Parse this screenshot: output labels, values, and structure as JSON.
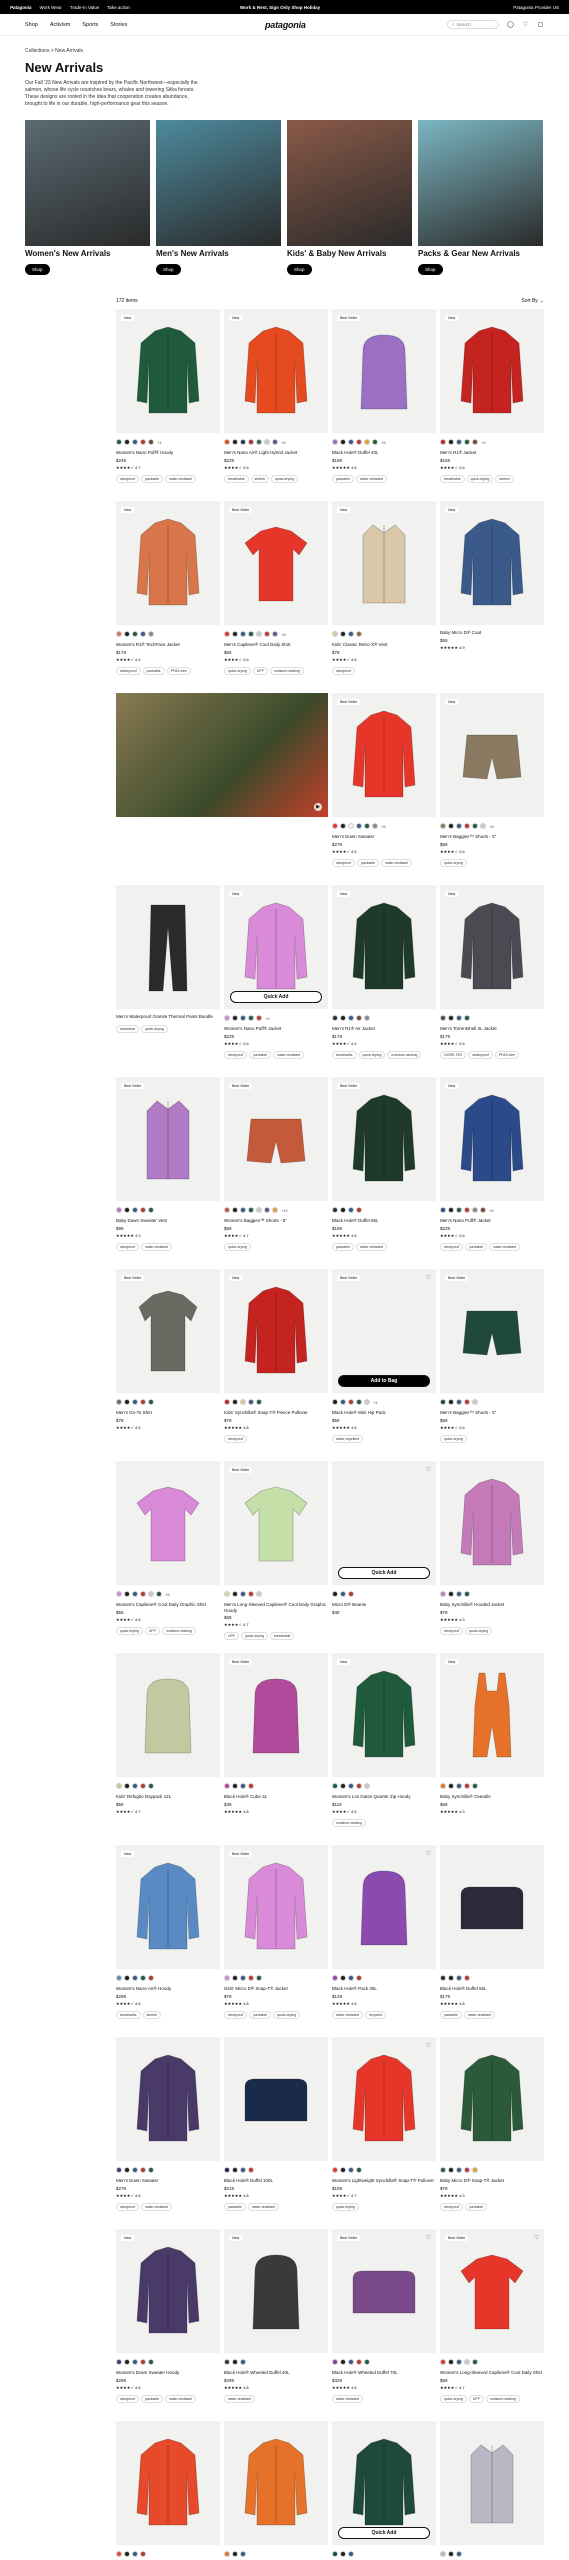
{
  "topbar": {
    "brand": "Patagonia",
    "links": [
      "Work Wear",
      "Trade-In Value",
      "Take action"
    ],
    "promo": "Work & Rest, Sign Only Shop Holiday",
    "locale": "Patagonia Provider US"
  },
  "nav": {
    "brand": "patagonia",
    "links": [
      "Shop",
      "Activism",
      "Sports",
      "Stories"
    ],
    "search": "Search"
  },
  "breadcrumb": {
    "parent": "Collections",
    "sep": ">",
    "current": "New Arrivals"
  },
  "page": {
    "title": "New Arrivals",
    "intro": "Our Fall '23 New Arrivals are inspired by the Pacific Northwest—especially the salmon, whose life cycle nourishes bears, whales and towering Sitka forests. These designs are rooted in the idea that cooperation creates abundance, brought to life in our durable, high-performance gear this season."
  },
  "categories": [
    {
      "label": "Women's New Arrivals",
      "cta": "Shop",
      "color": "#5a6b73"
    },
    {
      "label": "Men's New Arrivals",
      "cta": "Shop",
      "color": "#4d8a9e"
    },
    {
      "label": "Kids' & Baby New Arrivals",
      "cta": "Shop",
      "color": "#8a5a48"
    },
    {
      "label": "Packs & Gear New Arrivals",
      "cta": "Shop",
      "color": "#7bb6c2"
    }
  ],
  "listing": {
    "count": "172 items",
    "sort": "Sort By"
  },
  "colors": {
    "accent": "#000000"
  },
  "products": [
    {
      "badge": "New",
      "color": "#1f5a3d",
      "shape": "jacket",
      "swatches": [
        "#1f5a3d",
        "#222",
        "#3b5a8a",
        "#b33",
        "#6b4a3a"
      ],
      "more": "+4",
      "name": "Women's Nano Puff® Hoody",
      "price": "$249",
      "rating": "★★★★☆ 4.7",
      "tags": [
        "windproof",
        "packable",
        "water-resistant"
      ]
    },
    {
      "badge": "New",
      "color": "#e64a1f",
      "shape": "jacket",
      "swatches": [
        "#e64a1f",
        "#222",
        "#1f3a5a",
        "#a33",
        "#3b6b4a",
        "#ccc",
        "#6b4a8a"
      ],
      "more": "+6",
      "name": "Men's Nano Air® Light Hybrid Jacket",
      "price": "$229",
      "rating": "★★★★☆ 4.5",
      "tags": [
        "breathable",
        "stretch",
        "quick-drying"
      ]
    },
    {
      "badge": "Best Seller",
      "color": "#9b6fc4",
      "shape": "bag",
      "swatches": [
        "#9b6fc4",
        "#222",
        "#3b5a8a",
        "#b33",
        "#e6a23a",
        "#1f5a3d"
      ],
      "more": "+8",
      "name": "Black Hole® Duffel 40L",
      "price": "$169",
      "rating": "★★★★★ 4.8",
      "tags": [
        "packable",
        "water-resistant"
      ]
    },
    {
      "badge": "New",
      "color": "#c4231f",
      "shape": "jacket",
      "swatches": [
        "#c4231f",
        "#222",
        "#3b5a8a",
        "#1f5a3d",
        "#6b4a3a"
      ],
      "more": "+4",
      "name": "Men's R1® Jacket",
      "price": "$159",
      "rating": "★★★★☆ 4.6",
      "tags": [
        "breathable",
        "quick-drying",
        "stretch"
      ]
    },
    {
      "badge": "New",
      "color": "#d9754a",
      "shape": "jacket",
      "swatches": [
        "#d9754a",
        "#222",
        "#1f5a3d",
        "#3b5a8a",
        "#8a8a8a"
      ],
      "more": "",
      "name": "Women's R1® TechFace Jacket",
      "price": "$179",
      "rating": "★★★★☆ 4.4",
      "tags": [
        "waterproof",
        "packable",
        "PFAS-free"
      ]
    },
    {
      "badge": "Best Seller",
      "color": "#e6362a",
      "shape": "tee",
      "swatches": [
        "#e6362a",
        "#222",
        "#3b5a8a",
        "#1f5a3d",
        "#ccc",
        "#b33",
        "#6b4a8a"
      ],
      "more": "+8",
      "name": "Men's Capilene® Cool Daily Shirt",
      "price": "$55",
      "rating": "★★★★☆ 4.6",
      "tags": [
        "quick-drying",
        "UPF",
        "moisture-wicking"
      ]
    },
    {
      "badge": "New",
      "color": "#d9c8a8",
      "shape": "vest",
      "swatches": [
        "#d9c8a8",
        "#222",
        "#3b5a8a",
        "#8a6b4a"
      ],
      "more": "",
      "name": "Kids' Classic Retro-X® Vest",
      "price": "$79",
      "rating": "★★★★☆ 4.8",
      "tags": [
        "windproof"
      ]
    },
    {
      "badge": "New",
      "color": "#3a5a8a",
      "shape": "jacket",
      "swatches": [],
      "more": "",
      "name": "Baby Micro D® Coat",
      "price": "$59",
      "rating": "★★★★★ 4.9",
      "tags": []
    },
    {
      "feature": true,
      "color": "#6a6a52"
    },
    {
      "badge": "Best Seller",
      "color": "#e6362a",
      "shape": "jacket",
      "swatches": [
        "#e6362a",
        "#222",
        "#f1f1ef",
        "#3b5a8a",
        "#1f5a3d",
        "#8a8a8a"
      ],
      "more": "+8",
      "name": "Men's Down Sweater",
      "price": "$279",
      "rating": "★★★★☆ 4.5",
      "tags": [
        "windproof",
        "packable",
        "water-resistant"
      ]
    },
    {
      "badge": "New",
      "color": "#8a7a62",
      "shape": "shorts",
      "swatches": [
        "#8a7a62",
        "#222",
        "#3b5a8a",
        "#b33",
        "#1f5a3d",
        "#ccc"
      ],
      "more": "+8",
      "name": "Men's Baggies™ Shorts - 5\"",
      "price": "$59",
      "rating": "★★★★☆ 4.6",
      "tags": [
        "quick-drying"
      ]
    },
    {
      "badge": "",
      "color": "#2a2a2a",
      "shape": "pants",
      "swatches": [],
      "more": "",
      "name": "Men's Waterproof Granite Thermal Pants Bundle",
      "price": "",
      "rating": "",
      "tags": [
        "workwear",
        "quick-drying"
      ]
    },
    {
      "badge": "New",
      "color": "#d98ad9",
      "shape": "jacket",
      "qa": "Quick Add",
      "qaDark": false,
      "swatches": [
        "#d98ad9",
        "#222",
        "#3b5a8a",
        "#1f5a3d",
        "#b33"
      ],
      "more": "+4",
      "name": "Women's Nano Puff® Jacket",
      "price": "$229",
      "rating": "★★★★☆ 4.6",
      "tags": [
        "windproof",
        "packable",
        "water-resistant"
      ]
    },
    {
      "badge": "New",
      "color": "#1f3a2a",
      "shape": "jacket",
      "swatches": [
        "#1f3a2a",
        "#222",
        "#3b5a8a",
        "#6b4a3a",
        "#8a8a8a"
      ],
      "more": "",
      "name": "Men's R1® Air Jacket",
      "price": "$179",
      "rating": "★★★★☆ 4.4",
      "tags": [
        "breathable",
        "quick-drying",
        "moisture-wicking"
      ]
    },
    {
      "badge": "New",
      "color": "#4a4a52",
      "shape": "jacket",
      "swatches": [
        "#4a4a52",
        "#222",
        "#3b5a8a",
        "#1f5a3d"
      ],
      "more": "",
      "name": "Men's Torrentshell 3L Jacket",
      "price": "$179",
      "rating": "★★★★☆ 4.5",
      "tags": [
        "GORE-TEX",
        "waterproof",
        "PFAS-free"
      ]
    },
    {
      "badge": "Best Seller",
      "color": "#b07ac4",
      "shape": "vest",
      "swatches": [
        "#b07ac4",
        "#222",
        "#3b5a8a",
        "#b33",
        "#1f5a3d"
      ],
      "more": "",
      "name": "Baby Down Sweater Vest",
      "price": "$99",
      "rating": "★★★★★ 4.9",
      "tags": [
        "windproof",
        "water-resistant"
      ]
    },
    {
      "badge": "Best Seller",
      "color": "#c45a3a",
      "shape": "shorts",
      "swatches": [
        "#c45a3a",
        "#222",
        "#3b5a8a",
        "#1f5a3d",
        "#ccc",
        "#6b4a8a",
        "#e6a23a"
      ],
      "more": "+12",
      "name": "Women's Baggies™ Shorts - 5\"",
      "price": "$59",
      "rating": "★★★★☆ 4.7",
      "tags": [
        "quick-drying"
      ]
    },
    {
      "badge": "Best Seller",
      "color": "#1f3a2a",
      "shape": "jacket",
      "swatches": [
        "#1f3a2a",
        "#222",
        "#3b5a8a",
        "#b33"
      ],
      "more": "",
      "name": "Black Hole® Duffel 55L",
      "price": "$189",
      "rating": "★★★★★ 4.8",
      "tags": [
        "packable",
        "water-resistant"
      ]
    },
    {
      "badge": "New",
      "color": "#2a4a8a",
      "shape": "jacket",
      "swatches": [
        "#2a4a8a",
        "#222",
        "#1f5a3d",
        "#b33",
        "#8a8a8a",
        "#6b4a3a"
      ],
      "more": "+6",
      "name": "Men's Nano Puff® Jacket",
      "price": "$229",
      "rating": "★★★★☆ 4.6",
      "tags": [
        "windproof",
        "packable",
        "water-resistant"
      ]
    },
    {
      "badge": "Best Seller",
      "color": "#6a6a62",
      "shape": "shirt",
      "swatches": [
        "#6a6a62",
        "#222",
        "#3b5a8a",
        "#b33",
        "#1f5a3d"
      ],
      "more": "",
      "name": "Men's Go-To Shirt",
      "price": "$79",
      "rating": "★★★★☆ 4.5",
      "tags": []
    },
    {
      "badge": "New",
      "color": "#c4231f",
      "shape": "jacket",
      "swatches": [
        "#c4231f",
        "#222",
        "#d9c8a8",
        "#3b5a8a",
        "#1f5a3d"
      ],
      "more": "",
      "name": "Kids' Synchilla® Snap-T® Fleece Pullover",
      "price": "$79",
      "rating": "★★★★★ 4.8",
      "tags": [
        "windproof"
      ]
    },
    {
      "badge": "Best Seller",
      "color": "#f1f1ef",
      "shape": "none",
      "qa": "Add to Bag",
      "qaDark": true,
      "heart": true,
      "swatches": [
        "#222",
        "#3b5a8a",
        "#b33",
        "#1f5a3d",
        "#ccc"
      ],
      "more": "+4",
      "name": "Black Hole® Mini Hip Pack",
      "price": "$59",
      "rating": "★★★★★ 4.8",
      "tags": [
        "water-repellent"
      ]
    },
    {
      "badge": "Best Seller",
      "color": "#1f4a3a",
      "shape": "shorts",
      "swatches": [
        "#1f4a3a",
        "#222",
        "#3b5a8a",
        "#b33",
        "#ccc"
      ],
      "more": "",
      "name": "Men's Baggies™ Shorts - 5\"",
      "price": "$59",
      "rating": "★★★★☆ 4.6",
      "tags": [
        "quick-drying"
      ]
    },
    {
      "badge": "",
      "color": "#d98ad9",
      "shape": "tee",
      "swatches": [
        "#d98ad9",
        "#222",
        "#3b5a8a",
        "#b33",
        "#ccc",
        "#1f5a3d"
      ],
      "more": "+8",
      "name": "Women's Capilene® Cool Daily Graphic Shirt",
      "price": "$55",
      "rating": "★★★★☆ 4.6",
      "tags": [
        "quick-drying",
        "UPF",
        "moisture-wicking"
      ]
    },
    {
      "badge": "Best Seller",
      "color": "#c4e0a8",
      "shape": "tee",
      "swatches": [
        "#c4e0a8",
        "#222",
        "#3b5a8a",
        "#b33",
        "#ccc"
      ],
      "more": "",
      "name": "Men's Long-Sleeved Capilene® Cool Daily Graphic Hoody",
      "price": "$69",
      "rating": "★★★★☆ 4.7",
      "tags": [
        "UPF",
        "quick-drying",
        "breathable"
      ]
    },
    {
      "badge": "",
      "color": "#f1f1ef",
      "shape": "none",
      "qa": "Quick Add",
      "qaDark": false,
      "heart": true,
      "swatches": [
        "#222",
        "#3b5a8a",
        "#b33"
      ],
      "more": "",
      "name": "Micro D® Beanie",
      "price": "$49",
      "rating": "",
      "tags": []
    },
    {
      "badge": "",
      "color": "#c47ab8",
      "shape": "jacket",
      "swatches": [
        "#c47ab8",
        "#222",
        "#3b5a8a",
        "#1f5a3d"
      ],
      "more": "",
      "name": "Baby Synchilla® Hooded Jacket",
      "price": "$79",
      "rating": "★★★★★ 4.9",
      "tags": [
        "windproof",
        "quick-drying"
      ]
    },
    {
      "badge": "",
      "color": "#c4c8a0",
      "shape": "bag",
      "swatches": [
        "#c4c8a0",
        "#222",
        "#3b5a8a",
        "#b33",
        "#1f5a3d"
      ],
      "more": "",
      "name": "Kids' Refugito Daypack 12L",
      "price": "$59",
      "rating": "★★★★☆ 4.7",
      "tags": []
    },
    {
      "badge": "Best Seller",
      "color": "#b04a9a",
      "shape": "bag",
      "swatches": [
        "#b04a9a",
        "#222",
        "#3b5a8a",
        "#b33"
      ],
      "more": "",
      "name": "Black Hole® Cube 3L",
      "price": "$39",
      "rating": "★★★★★ 4.8",
      "tags": []
    },
    {
      "badge": "New",
      "color": "#1f5a3d",
      "shape": "jacket",
      "swatches": [
        "#1f5a3d",
        "#222",
        "#3b5a8a",
        "#b33",
        "#ccc"
      ],
      "more": "",
      "name": "Women's Los Gatos Quarter Zip Hoody",
      "price": "$119",
      "rating": "★★★★☆ 4.5",
      "tags": [
        "moisture-wicking"
      ]
    },
    {
      "badge": "New",
      "color": "#e6722a",
      "shape": "overalls",
      "swatches": [
        "#e6722a",
        "#222",
        "#3b5a8a",
        "#b33",
        "#1f5a3d"
      ],
      "more": "",
      "name": "Baby Synchilla® Overalls",
      "price": "$69",
      "rating": "★★★★★ 4.9",
      "tags": []
    },
    {
      "badge": "New",
      "color": "#5a8ac4",
      "shape": "jacket",
      "swatches": [
        "#5a8ac4",
        "#222",
        "#3b5a8a",
        "#1f5a3d",
        "#b33"
      ],
      "more": "",
      "name": "Women's Nano-Air® Hoody",
      "price": "$299",
      "rating": "★★★★☆ 4.6",
      "tags": [
        "breathable",
        "stretch"
      ]
    },
    {
      "badge": "Best Seller",
      "color": "#d98ad9",
      "shape": "jacket",
      "swatches": [
        "#d98ad9",
        "#222",
        "#3b5a8a",
        "#b33",
        "#1f5a3d"
      ],
      "more": "",
      "name": "Girls' Micro D® Snap-T® Jacket",
      "price": "$79",
      "rating": "★★★★★ 4.8",
      "tags": [
        "windproof",
        "packable",
        "quick-drying"
      ]
    },
    {
      "badge": "",
      "color": "#8a4ab0",
      "shape": "bag",
      "heart": true,
      "swatches": [
        "#8a4ab0",
        "#222",
        "#3b5a8a",
        "#b33"
      ],
      "more": "",
      "name": "Black Hole® Pack 25L",
      "price": "$129",
      "rating": "★★★★★ 4.8",
      "tags": [
        "water-resistant",
        "recycled"
      ]
    },
    {
      "badge": "",
      "color": "#2a2a3a",
      "shape": "duffel",
      "swatches": [
        "#2a2a3a",
        "#222",
        "#3b5a8a",
        "#b33"
      ],
      "more": "",
      "name": "Black Hole® Duffel 55L",
      "price": "$179",
      "rating": "★★★★★ 4.8",
      "tags": [
        "packable",
        "water-resistant"
      ]
    },
    {
      "badge": "",
      "color": "#4a3a6a",
      "shape": "jacket",
      "swatches": [
        "#4a3a6a",
        "#222",
        "#3b5a8a",
        "#b33",
        "#1f5a3d"
      ],
      "more": "",
      "name": "Men's Down Sweater",
      "price": "$279",
      "rating": "★★★★☆ 4.6",
      "tags": [
        "windproof",
        "water-resistant"
      ]
    },
    {
      "badge": "",
      "color": "#1a2a4a",
      "shape": "duffel",
      "swatches": [
        "#1a2a4a",
        "#222",
        "#3b5a8a",
        "#b33"
      ],
      "more": "",
      "name": "Black Hole® Duffel 100L",
      "price": "$219",
      "rating": "★★★★★ 4.8",
      "tags": [
        "packable",
        "water-resistant"
      ]
    },
    {
      "badge": "",
      "color": "#e6362a",
      "shape": "jacket",
      "heart": true,
      "swatches": [
        "#e6362a",
        "#222",
        "#3b5a8a",
        "#1f5a3d"
      ],
      "more": "",
      "name": "Women's Lightweight Synchilla® Snap-T® Pullover",
      "price": "$109",
      "rating": "★★★★☆ 4.7",
      "tags": [
        "quick-drying"
      ]
    },
    {
      "badge": "",
      "color": "#2a5a3a",
      "shape": "jacket",
      "swatches": [
        "#2a5a3a",
        "#222",
        "#3b5a8a",
        "#b33",
        "#e6a23a"
      ],
      "more": "",
      "name": "Baby Micro D® Snap-T® Jacket",
      "price": "$79",
      "rating": "★★★★★ 4.9",
      "tags": [
        "windproof",
        "packable"
      ]
    },
    {
      "badge": "New",
      "color": "#4a3a6a",
      "shape": "jacket",
      "swatches": [
        "#4a3a6a",
        "#222",
        "#3b5a8a",
        "#b33",
        "#1f5a3d"
      ],
      "more": "",
      "name": "Women's Down Sweater Hoody",
      "price": "$299",
      "rating": "★★★★☆ 4.6",
      "tags": [
        "windproof",
        "packable",
        "water-resistant"
      ]
    },
    {
      "badge": "New",
      "color": "#3a3a3a",
      "shape": "bag",
      "swatches": [
        "#3a3a3a",
        "#222",
        "#3b5a8a"
      ],
      "more": "",
      "name": "Black Hole® Wheeled Duffel 40L",
      "price": "$299",
      "rating": "★★★★★ 4.8",
      "tags": [
        "water-resistant"
      ]
    },
    {
      "badge": "Best Seller",
      "color": "#7a4a8a",
      "shape": "duffel",
      "heart": true,
      "swatches": [
        "#7a4a8a",
        "#222",
        "#3b5a8a",
        "#b33",
        "#1f5a3d"
      ],
      "more": "",
      "name": "Black Hole® Wheeled Duffel 70L",
      "price": "$329",
      "rating": "★★★★★ 4.8",
      "tags": [
        "water-resistant"
      ]
    },
    {
      "badge": "Best Seller",
      "color": "#e6362a",
      "shape": "tee",
      "heart": true,
      "swatches": [
        "#e6362a",
        "#222",
        "#3b5a8a",
        "#ccc",
        "#1f5a3d"
      ],
      "more": "",
      "name": "Women's Long-Sleeved Capilene® Cool Daily Shirt",
      "price": "$59",
      "rating": "★★★★☆ 4.7",
      "tags": [
        "quick-drying",
        "UPF",
        "moisture-wicking"
      ]
    },
    {
      "badge": "",
      "color": "#e64a2a",
      "shape": "jacket",
      "swatches": [
        "#e64a2a",
        "#222",
        "#3b5a8a",
        "#b33"
      ],
      "more": "",
      "name": "Women's Nano Puff® Hoody",
      "price": "$249",
      "rating": "★★★★☆ 4.7",
      "tags": []
    },
    {
      "badge": "",
      "color": "#e6722a",
      "shape": "jacket",
      "swatches": [
        "#e6722a",
        "#222",
        "#3b5a8a"
      ],
      "more": "",
      "name": "Men's Nano Puff® Jacket",
      "price": "$229",
      "rating": "★★★★☆ 4.6",
      "tags": []
    },
    {
      "badge": "",
      "color": "#1f4a3a",
      "shape": "jacket",
      "qa": "Quick Add",
      "qaDark": false,
      "swatches": [
        "#1f4a3a",
        "#222",
        "#3b5a8a"
      ],
      "more": "",
      "name": "Men's Better Sweater® Jacket",
      "price": "$149",
      "rating": "★★★★☆ 4.6",
      "tags": []
    },
    {
      "badge": "",
      "color": "#b8b8c4",
      "shape": "vest",
      "swatches": [
        "#b8b8c4",
        "#222",
        "#3b5a8a"
      ],
      "more": "",
      "name": "Women's Nano Puff® Vest",
      "price": "$179",
      "rating": "★★★★☆ 4.7",
      "tags": []
    }
  ]
}
